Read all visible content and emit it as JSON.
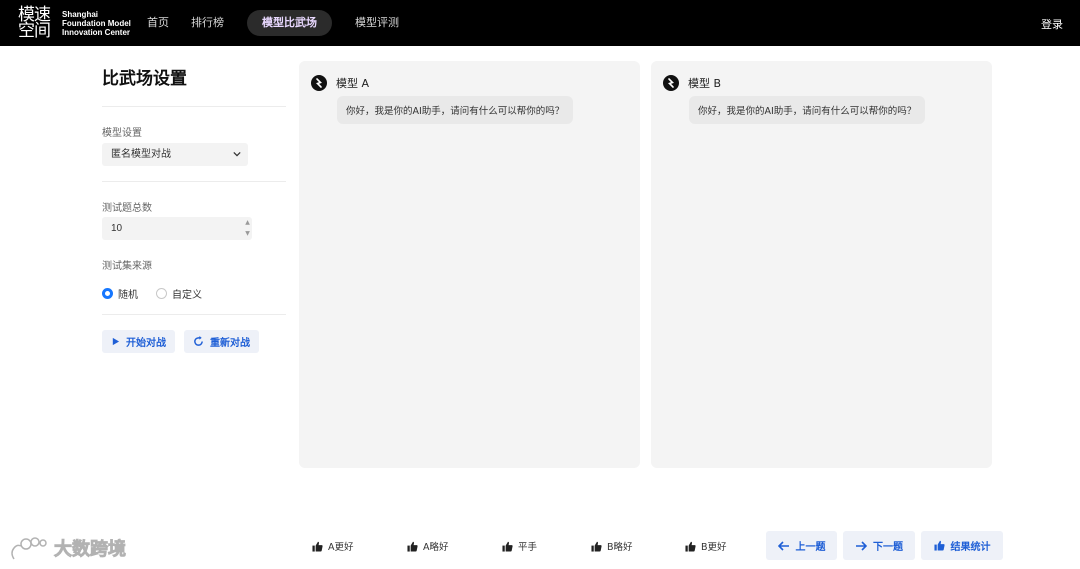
{
  "header": {
    "logo_mark": "模速空间",
    "logo_text_lines": [
      "Shanghai",
      "Foundation Model",
      "Innovation Center"
    ],
    "nav": [
      "首页",
      "排行榜",
      "模型比武场",
      "模型评测"
    ],
    "active_nav_index": 2,
    "login": "登录"
  },
  "sidebar": {
    "title": "比武场设置",
    "model_setting_label": "模型设置",
    "model_setting_value": "匿名模型对战",
    "question_count_label": "测试题总数",
    "question_count_value": "10",
    "source_label": "测试集来源",
    "source_options": [
      "随机",
      "自定义"
    ],
    "source_selected": "随机",
    "start_button": "开始对战",
    "restart_button": "重新对战"
  },
  "panels": [
    {
      "model": "模型 A",
      "message": "你好，我是你的AI助手，请问有什么可以帮你的吗？"
    },
    {
      "model": "模型 B",
      "message": "你好，我是你的AI助手，请问有什么可以帮你的吗？"
    }
  ],
  "votes": [
    "A更好",
    "A略好",
    "平手",
    "B略好",
    "B更好"
  ],
  "navigation": {
    "prev": "上一题",
    "next": "下一题",
    "stats": "结果统计"
  },
  "watermark": "大数跨境",
  "colors": {
    "header_bg": "#000000",
    "accent": "#1677ff",
    "button_text": "#1f5fd6",
    "panel_bg": "#f4f4f4"
  }
}
